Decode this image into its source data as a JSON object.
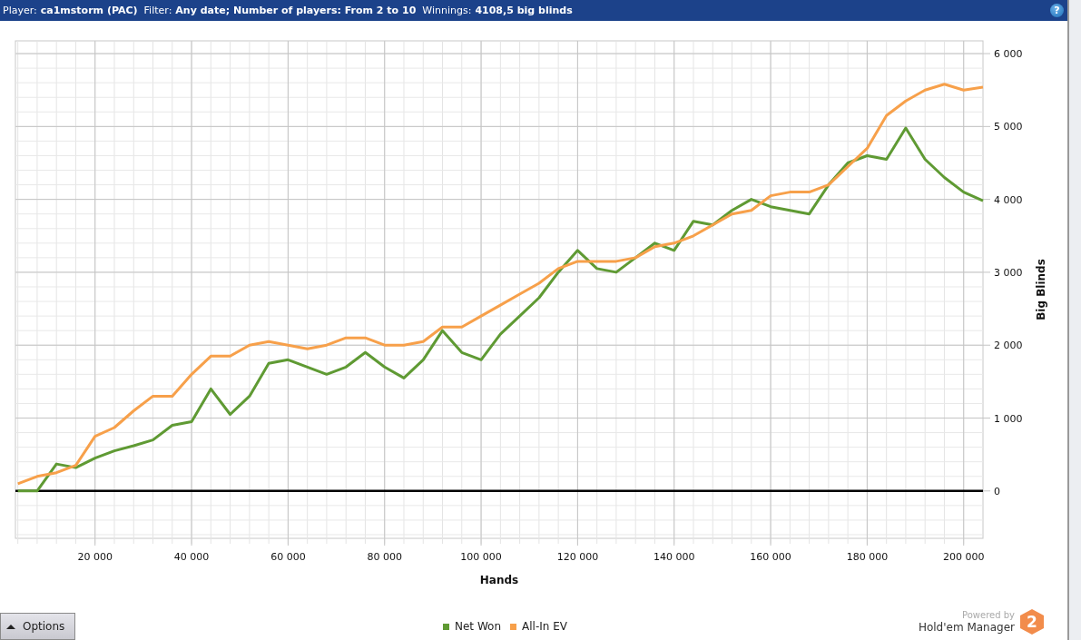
{
  "header": {
    "fields": [
      {
        "label": "Player:",
        "value": "ca1mstorm (PAC)"
      },
      {
        "label": "Filter:",
        "value": "Any date; Number of players: From 2 to 10"
      },
      {
        "label": "Winnings:",
        "value": "4108,5 big blinds"
      }
    ],
    "help": "?"
  },
  "chart": {
    "chart_data": {
      "type": "line",
      "grid": true,
      "xlabel": "Hands",
      "ylabel": "Big Blinds",
      "xlim": [
        3500,
        204000
      ],
      "ylim": [
        -650,
        6175
      ],
      "xticks": [
        {
          "value": 20000,
          "label": "20 000"
        },
        {
          "value": 40000,
          "label": "40 000"
        },
        {
          "value": 60000,
          "label": "60 000"
        },
        {
          "value": 80000,
          "label": "80 000"
        },
        {
          "value": 100000,
          "label": "100 000"
        },
        {
          "value": 120000,
          "label": "120 000"
        },
        {
          "value": 140000,
          "label": "140 000"
        },
        {
          "value": 160000,
          "label": "160 000"
        },
        {
          "value": 180000,
          "label": "180 000"
        },
        {
          "value": 200000,
          "label": "200 000"
        }
      ],
      "yticks": [
        {
          "value": 0,
          "label": "0"
        },
        {
          "value": 1000,
          "label": "1 000"
        },
        {
          "value": 2000,
          "label": "2 000"
        },
        {
          "value": 3000,
          "label": "3 000"
        },
        {
          "value": 4000,
          "label": "4 000"
        },
        {
          "value": 5000,
          "label": "5 000"
        },
        {
          "value": 6000,
          "label": "6 000"
        }
      ],
      "x": [
        4000,
        8000,
        12000,
        16000,
        20000,
        24000,
        28000,
        32000,
        36000,
        40000,
        44000,
        48000,
        52000,
        56000,
        60000,
        64000,
        68000,
        72000,
        76000,
        80000,
        84000,
        88000,
        92000,
        96000,
        100000,
        104000,
        108000,
        112000,
        116000,
        120000,
        124000,
        128000,
        132000,
        136000,
        140000,
        144000,
        148000,
        152000,
        156000,
        160000,
        164000,
        168000,
        172000,
        176000,
        180000,
        184000,
        188000,
        192000,
        196000,
        200000,
        204000
      ],
      "series": [
        {
          "name": "Net Won",
          "color": "#5f9a33",
          "values": [
            0,
            0,
            370,
            320,
            450,
            550,
            620,
            700,
            900,
            950,
            1400,
            1050,
            1300,
            1750,
            1800,
            1700,
            1600,
            1700,
            1900,
            1700,
            1550,
            1800,
            2200,
            1900,
            1800,
            2150,
            2400,
            2650,
            3000,
            3300,
            3050,
            3000,
            3200,
            3400,
            3300,
            3700,
            3650,
            3850,
            4000,
            3900,
            3850,
            3800,
            4200,
            4500,
            4600,
            4550,
            4980,
            4550,
            4300,
            4100,
            3980
          ]
        },
        {
          "name": "All-In EV",
          "color": "#f7a04a",
          "values": [
            100,
            200,
            250,
            350,
            750,
            870,
            1100,
            1300,
            1300,
            1600,
            1850,
            1850,
            2000,
            2050,
            2000,
            1950,
            2000,
            2100,
            2100,
            2000,
            2000,
            2050,
            2250,
            2250,
            2400,
            2550,
            2700,
            2850,
            3050,
            3150,
            3150,
            3150,
            3200,
            3350,
            3400,
            3500,
            3650,
            3800,
            3850,
            4050,
            4100,
            4100,
            4200,
            4450,
            4700,
            5150,
            5350,
            5500,
            5580,
            5500,
            5540
          ]
        }
      ]
    }
  },
  "footer": {
    "options_button": "Options",
    "powered_by": "Powered by",
    "brand": "Hold'em Manager",
    "logo": "2"
  }
}
